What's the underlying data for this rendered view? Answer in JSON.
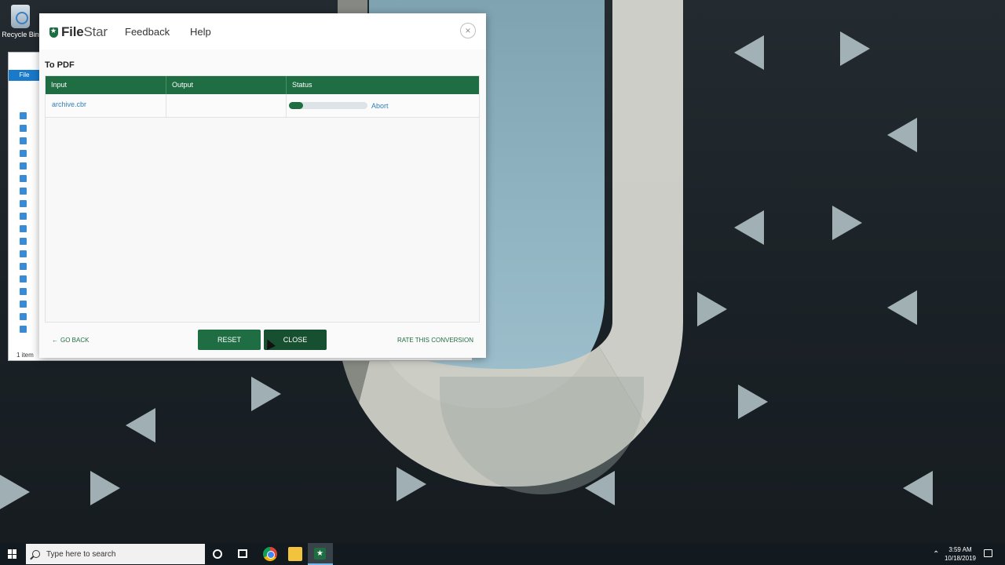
{
  "desktop": {
    "recycle_bin_label": "Recycle Bin"
  },
  "explorer": {
    "file_tab": "File",
    "status": "1 item"
  },
  "dialog": {
    "logo_bold": "File",
    "logo_light": "Star",
    "nav_feedback": "Feedback",
    "nav_help": "Help",
    "close_symbol": "×",
    "section_title": "To PDF",
    "columns": {
      "input": "Input",
      "output": "Output",
      "status": "Status"
    },
    "row": {
      "input_file": "archive.cbr",
      "output_file": "",
      "progress_fraction": 0.18,
      "abort_label": "Abort"
    },
    "footer": {
      "go_back": "GO BACK",
      "reset": "RESET",
      "close": "CLOSE",
      "rate": "RATE THIS CONVERSION"
    },
    "accent_color": "#1f6e43",
    "link_color": "#2f7fb9"
  },
  "taskbar": {
    "search_placeholder": "Type here to search",
    "time": "3:59 AM",
    "date": "10/18/2019",
    "icons": [
      "windows-start-icon",
      "cortana-icon",
      "task-view-icon",
      "chrome-icon",
      "file-explorer-icon",
      "filestar-icon",
      "notification-icon"
    ]
  }
}
